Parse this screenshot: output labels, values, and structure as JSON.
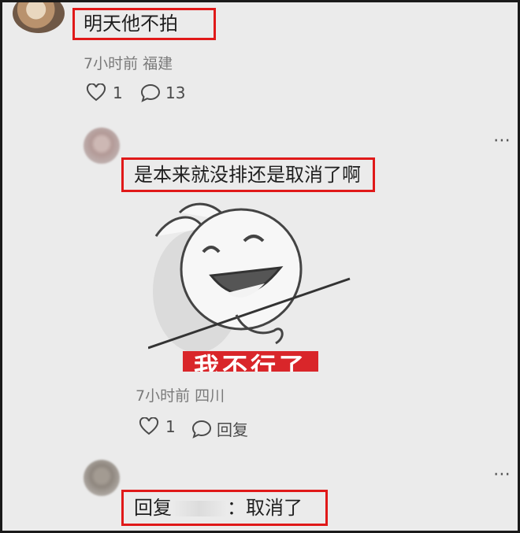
{
  "comments": [
    {
      "text": "明天他不拍",
      "meta": "7小时前 福建",
      "likes": "1",
      "replies": "13"
    },
    {
      "text": "是本来就没排还是取消了啊",
      "sticker_caption": "我不行了",
      "meta": "7小时前 四川",
      "likes": "1",
      "reply_label": "回复",
      "more_label": "⋯"
    },
    {
      "prefix": "回复",
      "suffix": "：取消了",
      "more_label": "⋯"
    }
  ],
  "colors": {
    "background": "#ebebeb",
    "highlight_border": "#e01919",
    "caption_bg": "#d9262a"
  },
  "icons": [
    "heart-icon",
    "comment-bubble-icon",
    "more-icon"
  ]
}
